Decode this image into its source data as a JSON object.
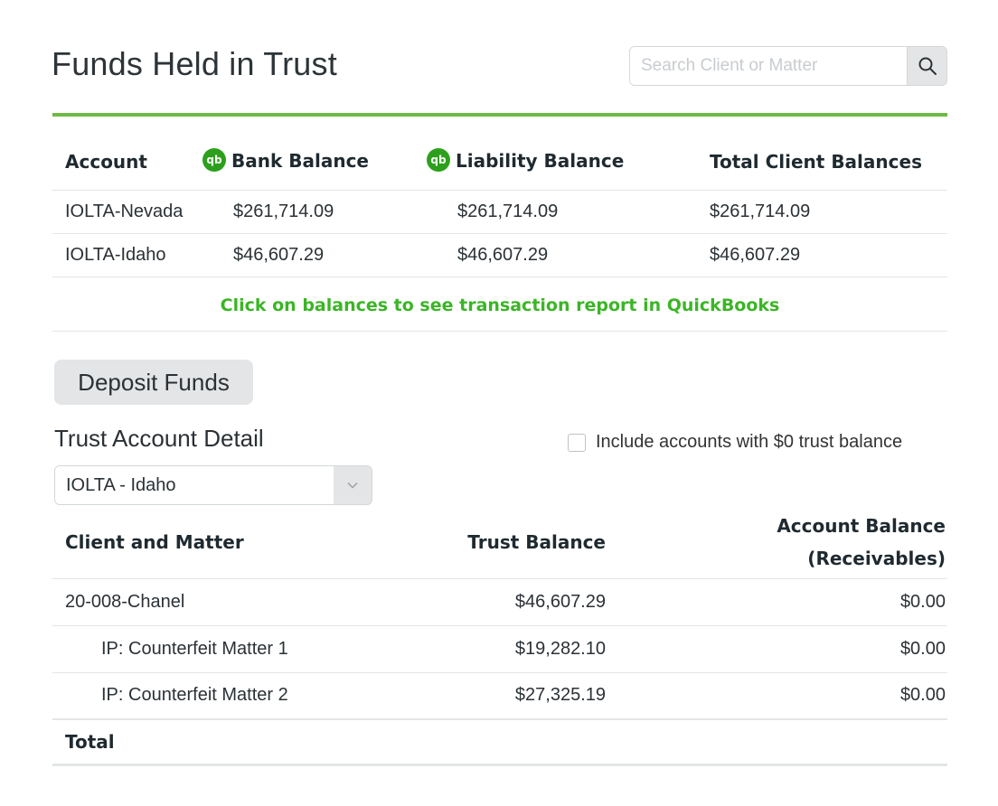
{
  "page": {
    "title": "Funds Held in Trust"
  },
  "search": {
    "placeholder": "Search Client or Matter"
  },
  "colors": {
    "accent_green": "#6fb944",
    "qb_green": "#2ca01c",
    "hint_green": "#3bb526"
  },
  "summary": {
    "headers": {
      "account": "Account",
      "bank": "Bank Balance",
      "liability": "Liability Balance",
      "total": "Total Client Balances"
    },
    "qb_icon_text": "qb",
    "rows": [
      {
        "account": "IOLTA-Nevada",
        "bank": "$261,714.09",
        "liability": "$261,714.09",
        "total": "$261,714.09"
      },
      {
        "account": "IOLTA-Idaho",
        "bank": "$46,607.29",
        "liability": "$46,607.29",
        "total": "$46,607.29"
      }
    ],
    "hint": "Click on balances to see transaction report in QuickBooks"
  },
  "deposit": {
    "label": "Deposit Funds"
  },
  "detail": {
    "title": "Trust Account Detail",
    "zero_checkbox_label": "Include accounts with $0 trust balance",
    "zero_checkbox_checked": false,
    "selected_account": "IOLTA - Idaho",
    "headers": {
      "client": "Client and Matter",
      "trust": "Trust Balance",
      "account_line1": "Account Balance",
      "account_line2": "(Receivables)"
    },
    "rows": [
      {
        "name": "20-008-Chanel",
        "trust": "$46,607.29",
        "account": "$0.00"
      },
      {
        "name": "IP: Counterfeit Matter 1",
        "trust": "$19,282.10",
        "account": "$0.00"
      },
      {
        "name": "IP: Counterfeit Matter 2",
        "trust": "$27,325.19",
        "account": "$0.00"
      }
    ],
    "total_label": "Total"
  }
}
